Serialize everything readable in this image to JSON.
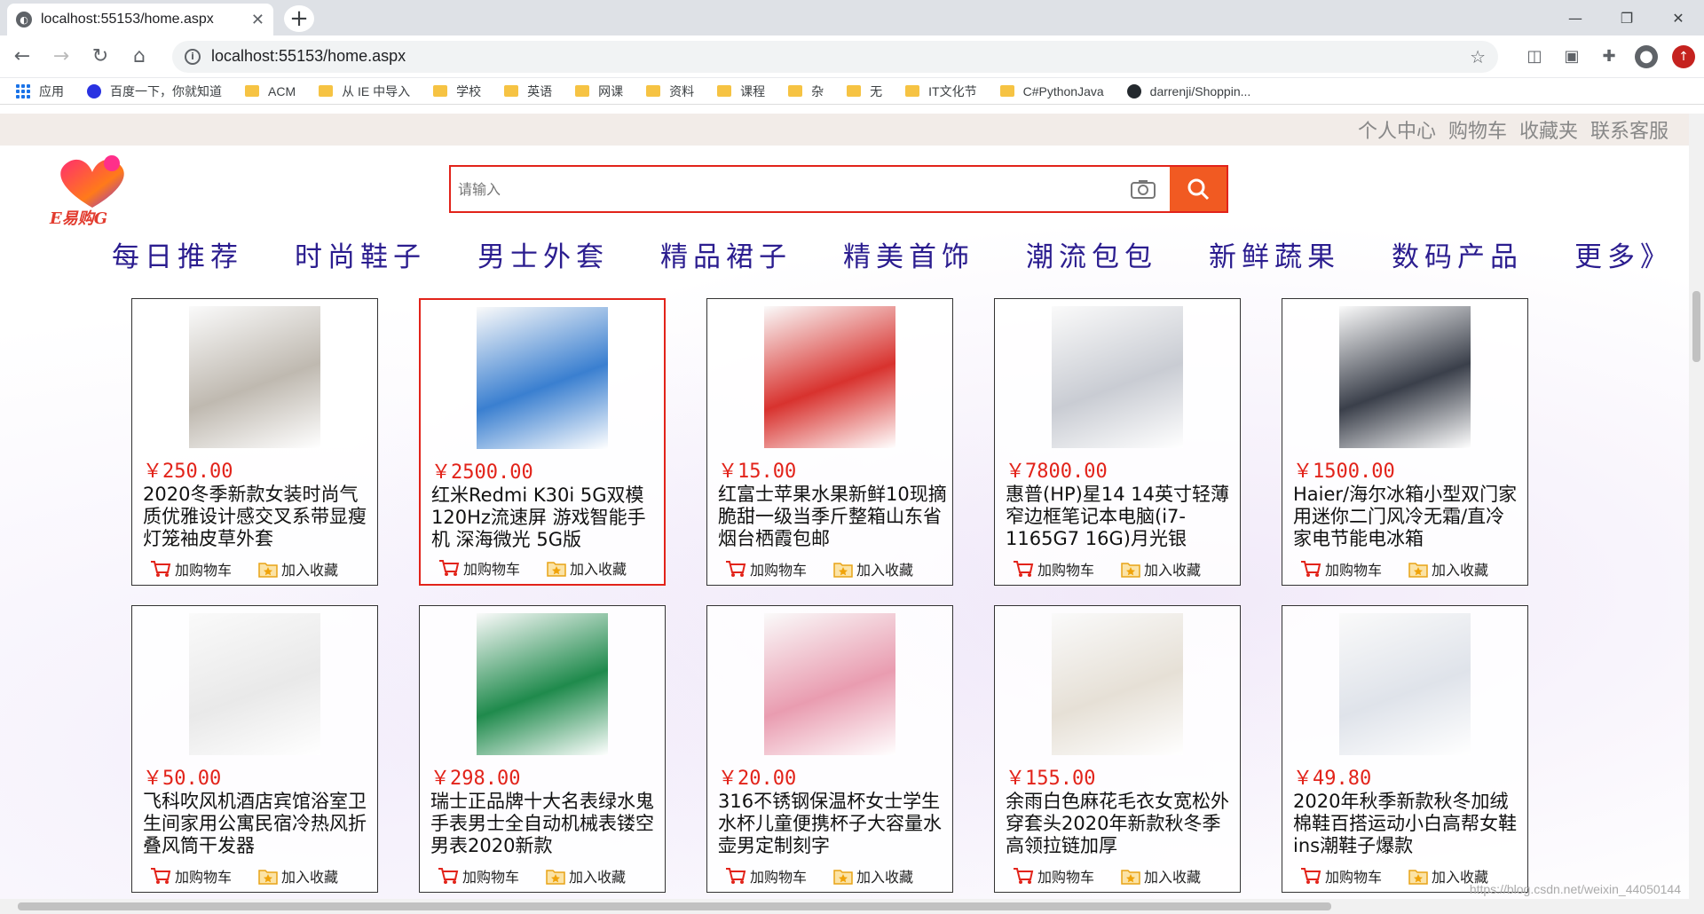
{
  "browser": {
    "tab_title": "localhost:55153/home.aspx",
    "url": "localhost:55153/home.aspx",
    "bookmarks": [
      "应用",
      "百度一下，你就知道",
      "ACM",
      "从 IE 中导入",
      "学校",
      "英语",
      "网课",
      "资料",
      "课程",
      "杂",
      "无",
      "IT文化节",
      "C#PythonJava",
      "darrenji/Shoppin..."
    ]
  },
  "topbar": {
    "links": [
      "个人中心",
      "购物车",
      "收藏夹",
      "联系客服"
    ]
  },
  "logo": {
    "text": "E易购G"
  },
  "search": {
    "placeholder": "请输入"
  },
  "categories": [
    "每日推荐",
    "时尚鞋子",
    "男士外套",
    "精品裙子",
    "精美首饰",
    "潮流包包",
    "新鲜蔬果",
    "数码产品",
    "更多》"
  ],
  "products": [
    {
      "price": "￥250.00",
      "name": "2020冬季新款女装时尚气质优雅设计感交叉系带显瘦灯笼袖皮草外套",
      "color": "#bfb9b0"
    },
    {
      "price": "￥2500.00",
      "name": "红米Redmi K30i 5G双模120Hz流速屏 游戏智能手机 深海微光 5G版",
      "color": "#3a7fd0"
    },
    {
      "price": "￥15.00",
      "name": "红富士苹果水果新鲜10现摘脆甜一级当季斤整箱山东省烟台栖霞包邮",
      "color": "#d8322e"
    },
    {
      "price": "￥7800.00",
      "name": "惠普(HP)星14 14英寸轻薄窄边框笔记本电脑(i7-1165G7 16G)月光银",
      "color": "#c9ccd3"
    },
    {
      "price": "￥1500.00",
      "name": "Haier/海尔冰箱小型双门家用迷你二门风冷无霜/直冷家电节能电冰箱",
      "color": "#3a3f4a"
    },
    {
      "price": "￥50.00",
      "name": "飞科吹风机酒店宾馆浴室卫生间家用公寓民宿冷热风折叠风筒干发器",
      "color": "#e9e9e9"
    },
    {
      "price": "￥298.00",
      "name": "瑞士正品牌十大名表绿水鬼手表男士全自动机械表镂空男表2020新款",
      "color": "#1f8a4c"
    },
    {
      "price": "￥20.00",
      "name": "316不锈钢保温杯女士学生水杯儿童便携杯子大容量水壶男定制刻字",
      "color": "#e99cb0"
    },
    {
      "price": "￥155.00",
      "name": "余雨白色麻花毛衣女宽松外穿套头2020年新款秋冬季高领拉链加厚",
      "color": "#e6e0d6"
    },
    {
      "price": "￥49.80",
      "name": "2020年秋季新款秋冬加绒棉鞋百搭运动小白高帮女鞋ins潮鞋子爆款",
      "color": "#dfe3ea"
    }
  ],
  "card_actions": {
    "cart": "加购物车",
    "fav": "加入收藏"
  },
  "active_product_index": 1,
  "colors": {
    "accent": "#e2231a",
    "search_button": "#f15a22",
    "category": "#2b1d8f"
  },
  "watermark": "https://blog.csdn.net/weixin_44050144"
}
